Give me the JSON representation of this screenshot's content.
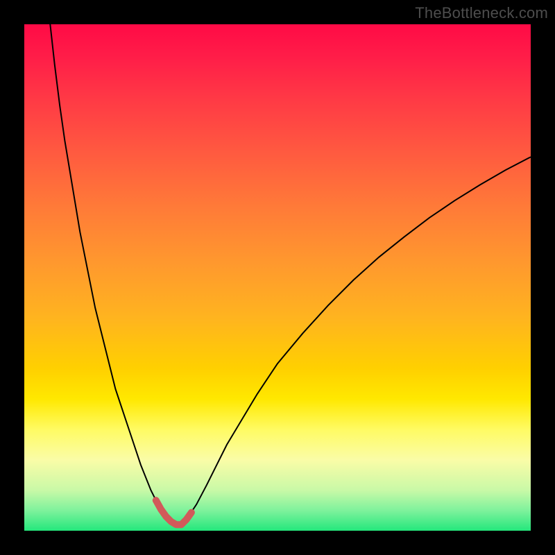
{
  "watermark": "TheBottleneck.com",
  "chart_data": {
    "type": "line",
    "title": "",
    "xlabel": "",
    "ylabel": "",
    "xlim": [
      0,
      100
    ],
    "ylim": [
      0,
      100
    ],
    "grid": false,
    "legend": false,
    "series": [
      {
        "name": "curve",
        "color": "#000000",
        "stroke_width": 2,
        "x": [
          5,
          6,
          7,
          8,
          9,
          10,
          11,
          12,
          13,
          14,
          15,
          16,
          17,
          18,
          19,
          20,
          21,
          22,
          23,
          24,
          25,
          26,
          27,
          28,
          29,
          30,
          31,
          32,
          34,
          36,
          38,
          40,
          43,
          46,
          50,
          55,
          60,
          65,
          70,
          75,
          80,
          85,
          90,
          95,
          100
        ],
        "y": [
          101,
          92,
          84,
          77,
          71,
          65,
          59,
          54,
          49,
          44,
          40,
          36,
          32,
          28,
          25,
          22,
          19,
          16,
          13,
          10.5,
          8,
          6,
          4.2,
          2.8,
          1.8,
          1.2,
          1.2,
          2.2,
          5.2,
          9,
          13,
          17,
          22,
          27,
          33,
          39,
          44.5,
          49.5,
          54,
          58,
          61.8,
          65.2,
          68.3,
          71.2,
          73.8
        ]
      },
      {
        "name": "highlight",
        "color": "#d15a5a",
        "stroke_width": 10,
        "linecap": "round",
        "x": [
          26,
          27,
          28,
          29,
          30,
          31,
          32,
          33
        ],
        "y": [
          6,
          4.2,
          2.8,
          1.8,
          1.2,
          1.2,
          2.2,
          3.6
        ]
      }
    ],
    "background_gradient": {
      "type": "vertical",
      "stops": [
        {
          "pos": 0,
          "color": "#ff0a46"
        },
        {
          "pos": 0.5,
          "color": "#ffb41f"
        },
        {
          "pos": 0.75,
          "color": "#ffe800"
        },
        {
          "pos": 1,
          "color": "#24e77c"
        }
      ]
    }
  }
}
